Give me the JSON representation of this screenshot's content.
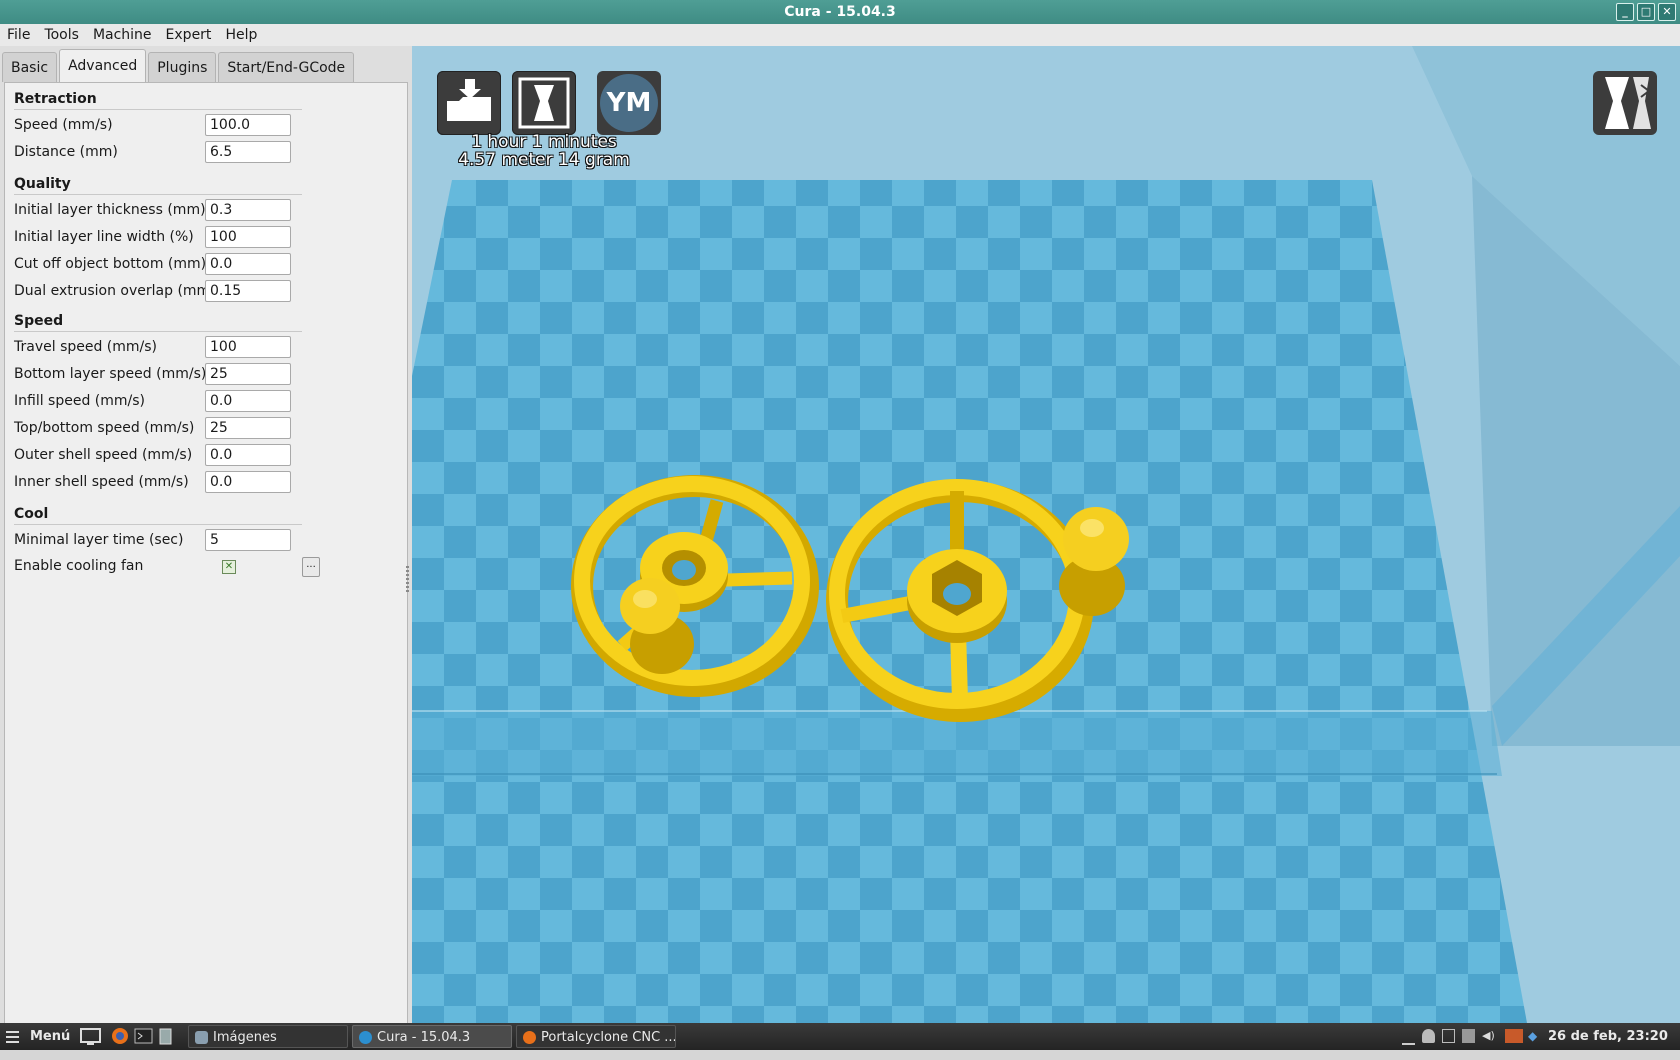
{
  "window": {
    "title": "Cura - 15.04.3",
    "controls": [
      "_",
      "□",
      "✕"
    ]
  },
  "menubar": [
    "File",
    "Tools",
    "Machine",
    "Expert",
    "Help"
  ],
  "tabs": [
    "Basic",
    "Advanced",
    "Plugins",
    "Start/End-GCode"
  ],
  "active_tab": "Advanced",
  "sections": {
    "retraction": {
      "title": "Retraction",
      "speed": {
        "label": "Speed (mm/s)",
        "value": "100.0"
      },
      "distance": {
        "label": "Distance (mm)",
        "value": "6.5"
      }
    },
    "quality": {
      "title": "Quality",
      "initial_layer_thickness": {
        "label": "Initial layer thickness (mm)",
        "value": "0.3"
      },
      "initial_layer_line_width": {
        "label": "Initial layer line width (%)",
        "value": "100"
      },
      "cut_off_object_bottom": {
        "label": "Cut off object bottom (mm)",
        "value": "0.0"
      },
      "dual_extrusion_overlap": {
        "label": "Dual extrusion overlap (mm)",
        "value": "0.15"
      }
    },
    "speed": {
      "title": "Speed",
      "travel_speed": {
        "label": "Travel speed (mm/s)",
        "value": "100"
      },
      "bottom_layer_speed": {
        "label": "Bottom layer speed (mm/s)",
        "value": "25"
      },
      "infill_speed": {
        "label": "Infill speed (mm/s)",
        "value": "0.0"
      },
      "top_bottom_speed": {
        "label": "Top/bottom speed (mm/s)",
        "value": "25"
      },
      "outer_shell_speed": {
        "label": "Outer shell speed (mm/s)",
        "value": "0.0"
      },
      "inner_shell_speed": {
        "label": "Inner shell speed (mm/s)",
        "value": "0.0"
      }
    },
    "cool": {
      "title": "Cool",
      "minimal_layer_time": {
        "label": "Minimal layer time (sec)",
        "value": "5"
      },
      "enable_cooling_fan": {
        "label": "Enable cooling fan",
        "checked": true,
        "more_label": "..."
      }
    }
  },
  "viewport": {
    "print_time": "1 hour 1 minutes",
    "print_material": "4.57 meter 14 gram",
    "ym_button_label": "YM",
    "colors": {
      "background": "#9fcbe0",
      "plate_light": "#69bde0",
      "plate_dark": "#4fa6cf",
      "model": "#f7d21c"
    }
  },
  "taskbar": {
    "menu_label": "Menú",
    "tasks": [
      {
        "label": "Imágenes",
        "active": false
      },
      {
        "label": "Cura - 15.04.3",
        "active": true
      },
      {
        "label": "Portalcyclone CNC ...",
        "active": false
      }
    ],
    "clock": "26 de feb, 23:20"
  }
}
